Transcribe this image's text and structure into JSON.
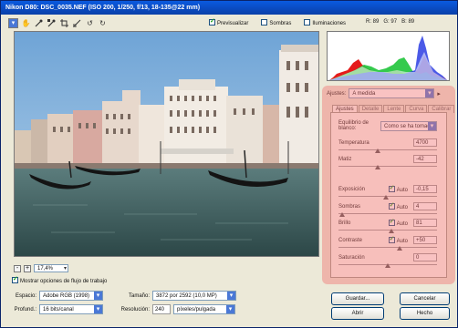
{
  "window": {
    "title": "Nikon D80:  DSC_0035.NEF  (ISO 200, 1/250, f/13, 18-135@22 mm)"
  },
  "toolbar": {
    "tools": [
      "zoom-icon",
      "hand-icon",
      "white-balance-eyedropper-icon",
      "color-sampler-icon",
      "crop-icon",
      "straighten-icon",
      "rotate-ccw-icon",
      "rotate-cw-icon"
    ]
  },
  "view_options": {
    "preview_label": "Previsualizar",
    "preview_checked": true,
    "shadows_label": "Sombras",
    "shadows_checked": false,
    "highlights_label": "Iluminaciones",
    "highlights_checked": false
  },
  "readout": {
    "r_label": "R:",
    "r": "89",
    "g_label": "G:",
    "g": "97",
    "b_label": "B:",
    "b": "89"
  },
  "zoom": {
    "minus": "-",
    "plus": "+",
    "value": "17,4%"
  },
  "workflow": {
    "show_label": "Mostrar opciones de flujo de trabajo",
    "show_checked": true,
    "space_label": "Espacio:",
    "space_value": "Adobe RGB (1998)",
    "depth_label": "Profund.:",
    "depth_value": "16 bits/canal",
    "size_label": "Tamaño:",
    "size_value": "3872 por 2592  (10,0 MP)",
    "res_label": "Resolución:",
    "res_value": "240",
    "res_unit": "píxeles/pulgada"
  },
  "adjust": {
    "label": "Ajustes:",
    "value": "A medida"
  },
  "tabs": [
    "Ajustes",
    "Detalle",
    "Lente",
    "Curva",
    "Calibrar"
  ],
  "white_balance": {
    "label": "Equilibrio de blanco:",
    "value": "Como se ha tomado"
  },
  "params": [
    {
      "name": "temperature",
      "label": "Temperatura",
      "value": "4700",
      "auto": null,
      "level": 0.4
    },
    {
      "name": "tint",
      "label": "Matiz",
      "value": "-42",
      "auto": null,
      "level": 0.4
    },
    {
      "name": "exposure",
      "label": "Exposición",
      "value": "-0,15",
      "auto": "Auto",
      "level": 0.48
    },
    {
      "name": "shadows",
      "label": "Sombras",
      "value": "4",
      "auto": "Auto",
      "level": 0.04
    },
    {
      "name": "brightness",
      "label": "Brillo",
      "value": "81",
      "auto": "Auto",
      "level": 0.54
    },
    {
      "name": "contrast",
      "label": "Contraste",
      "value": "+50",
      "auto": "Auto",
      "level": 0.62
    },
    {
      "name": "saturation",
      "label": "Saturación",
      "value": "0",
      "auto": null,
      "level": 0.5
    }
  ],
  "buttons": {
    "save": "Guardar...",
    "cancel": "Cancelar",
    "open": "Abrir",
    "done": "Hecho"
  },
  "colors": {
    "title_bar": "#0a4fd0",
    "highlight_overlay": "#f06e6e",
    "sky": "#8db8dc",
    "water": "#3c5c5a"
  }
}
